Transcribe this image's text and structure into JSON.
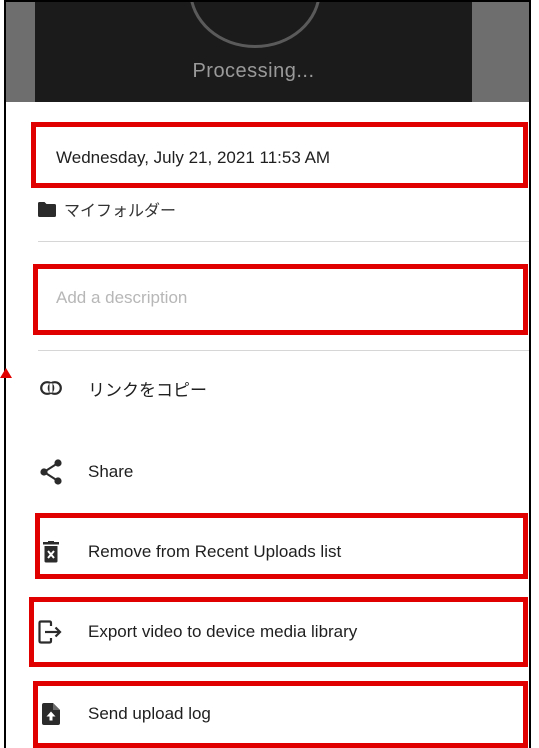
{
  "video": {
    "status": "Processing..."
  },
  "details": {
    "date": "Wednesday, July 21, 2021 11:53 AM",
    "folder": "マイフォルダー",
    "description_placeholder": "Add a description"
  },
  "menu": {
    "copy_link": "リンクをコピー",
    "share": "Share",
    "remove": "Remove from Recent Uploads list",
    "export": "Export video to device media library",
    "send_log": "Send upload log"
  },
  "colors": {
    "highlight": "#e00000",
    "text": "#1f1f1f",
    "placeholder": "#b7b7b7"
  }
}
